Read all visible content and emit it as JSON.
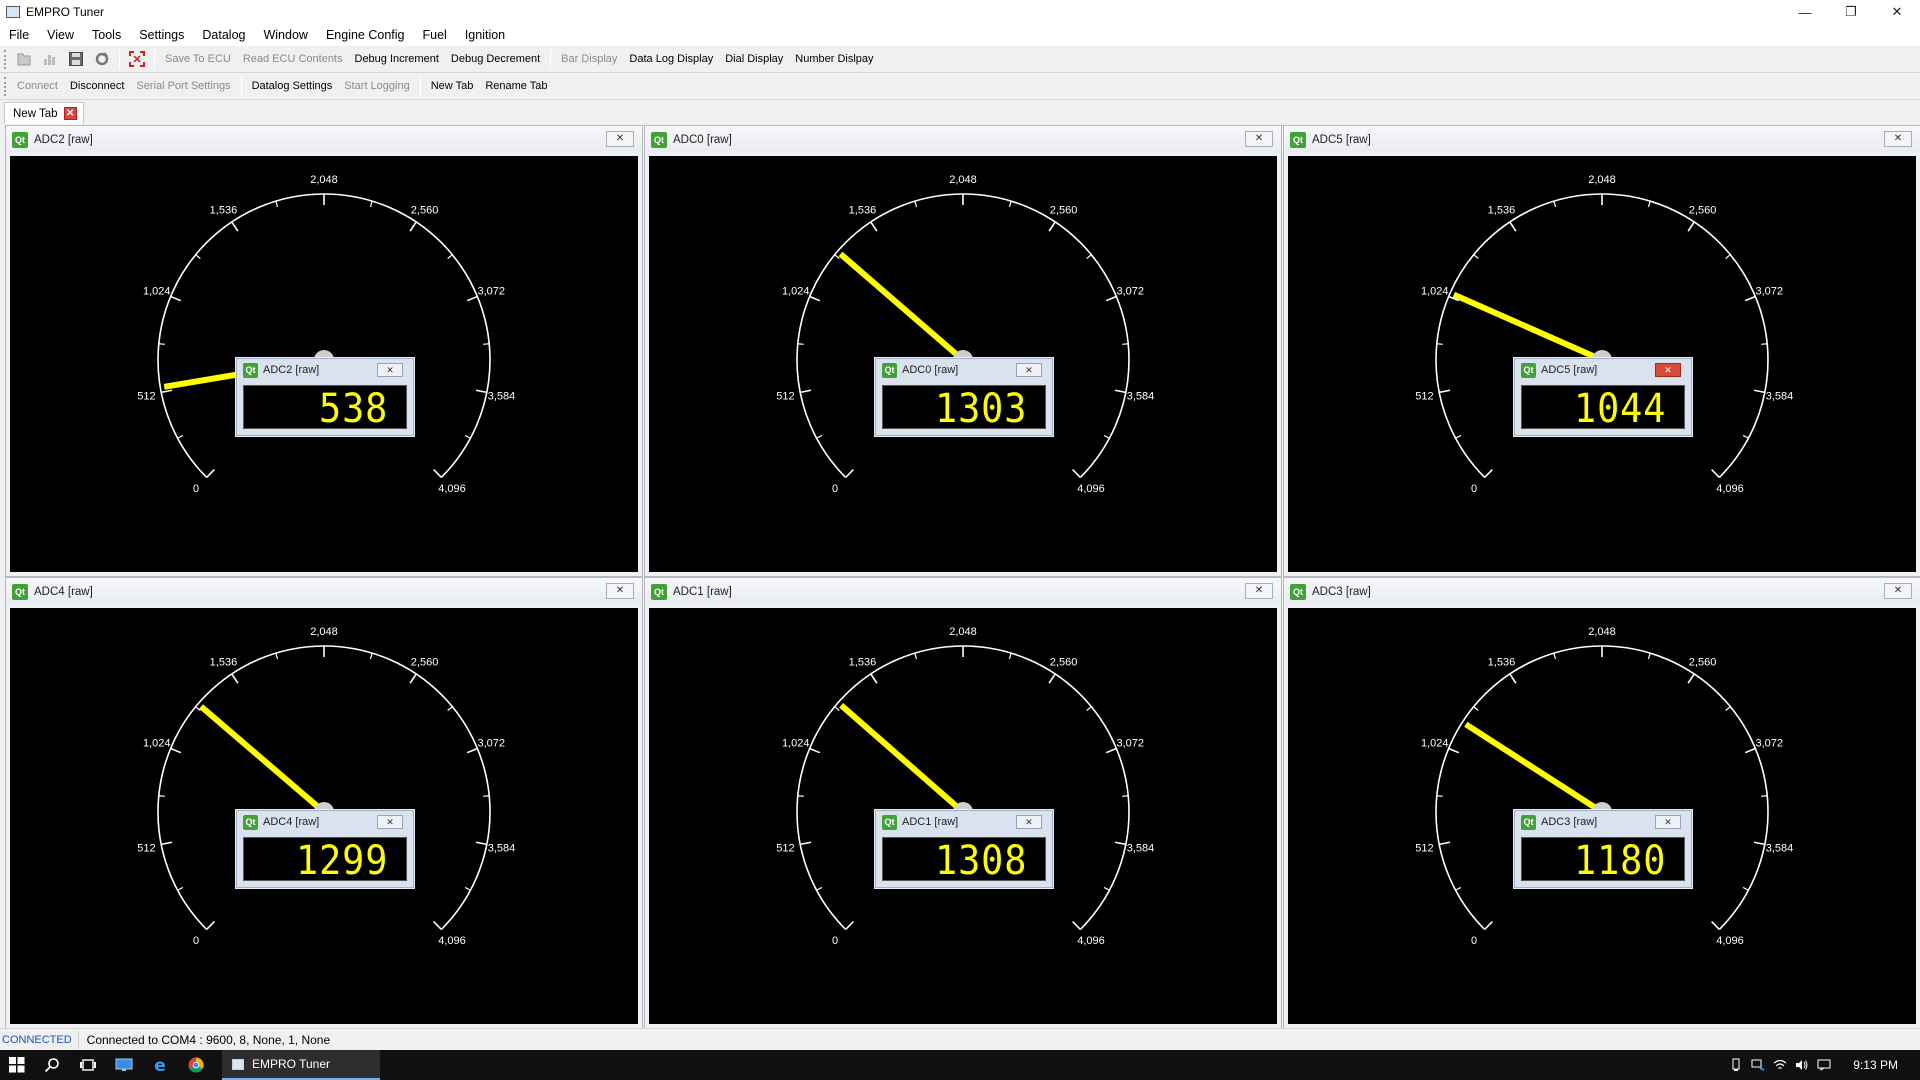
{
  "window": {
    "title": "EMPRO Tuner",
    "minimize_icon": "minimize-icon",
    "restore_icon": "restore-icon",
    "close_icon": "close-icon"
  },
  "menu": [
    "File",
    "View",
    "Tools",
    "Settings",
    "Datalog",
    "Window",
    "Engine Config",
    "Fuel",
    "Ignition"
  ],
  "toolbar1": {
    "icons": [
      "open-file-icon",
      "chart-icon",
      "save-icon",
      "refresh-icon",
      "fullscreen-icon"
    ],
    "save_to_ecu": "Save To ECU",
    "read_ecu": "Read ECU Contents",
    "debug_inc": "Debug Increment",
    "debug_dec": "Debug Decrement",
    "bar_display": "Bar Display",
    "datalog_display": "Data Log Display",
    "dial_display": "Dial Display",
    "number_display": "Number Dislpay"
  },
  "toolbar2": {
    "connect": "Connect",
    "disconnect": "Disconnect",
    "serial_settings": "Serial Port Settings",
    "datalog_settings": "Datalog Settings",
    "start_logging": "Start Logging",
    "new_tab": "New Tab",
    "rename_tab": "Rename Tab"
  },
  "tabs": [
    {
      "label": "New Tab"
    }
  ],
  "close_glyph": "✕",
  "qt_glyph": "Qt",
  "gauge_scale": {
    "min": 0,
    "max": 4096,
    "ticks": [
      "0",
      "512",
      "1,024",
      "1,536",
      "2,048",
      "2,560",
      "3,072",
      "3,584",
      "4,096"
    ]
  },
  "gauges": [
    {
      "title": "ADC2 [raw]",
      "value": 538,
      "display": "538",
      "active_close": false
    },
    {
      "title": "ADC0 [raw]",
      "value": 1303,
      "display": "1303",
      "active_close": false
    },
    {
      "title": "ADC5 [raw]",
      "value": 1044,
      "display": "1044",
      "active_close": true
    },
    {
      "title": "ADC4 [raw]",
      "value": 1299,
      "display": "1299",
      "active_close": false
    },
    {
      "title": "ADC1 [raw]",
      "value": 1308,
      "display": "1308",
      "active_close": false
    },
    {
      "title": "ADC3 [raw]",
      "value": 1180,
      "display": "1180",
      "active_close": false
    }
  ],
  "status": {
    "connection": "CONNECTED",
    "message": "Connected to COM4 : 9600, 8, None, 1, None"
  },
  "taskbar": {
    "app_label": "EMPRO Tuner",
    "time": "9:13 PM",
    "icons": [
      "windows-start-icon",
      "search-icon",
      "task-view-icon",
      "desktop-icon",
      "edge-icon",
      "chrome-icon"
    ],
    "tray_icons": [
      "usb-icon",
      "network-icon",
      "wifi-icon",
      "volume-icon",
      "notification-icon"
    ]
  },
  "colors": {
    "needle": "#ffff00",
    "dial": "#ffffff",
    "lcd": "#ffff00",
    "status_connected": "#1b55c4"
  }
}
